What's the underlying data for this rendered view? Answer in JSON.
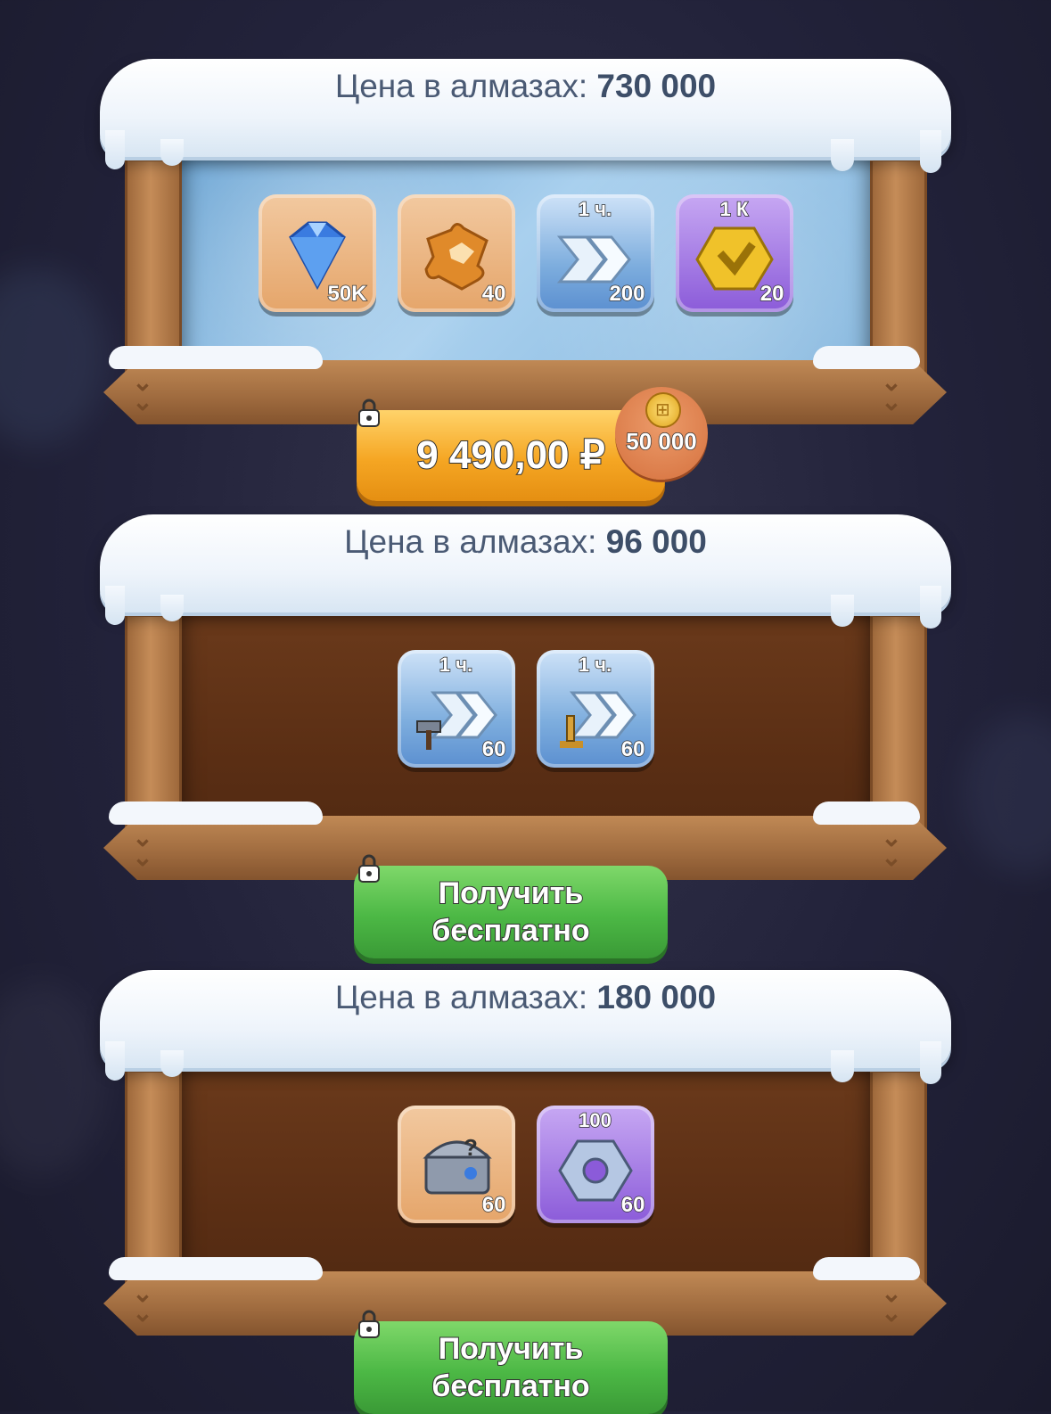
{
  "offers": [
    {
      "price_label": "Цена в алмазах:",
      "price_value": "730 000",
      "items": [
        {
          "icon": "diamond-icon",
          "count": "50K"
        },
        {
          "icon": "puzzle-piece-icon",
          "count": "40"
        },
        {
          "icon": "speedup-icon",
          "top_label": "1 ч.",
          "count": "200"
        },
        {
          "icon": "gold-hexagon-icon",
          "top_label": "1 К",
          "count": "20"
        }
      ],
      "button_label": "9 490,00 ₽",
      "bonus": "50 000"
    },
    {
      "price_label": "Цена в алмазах:",
      "price_value": "96 000",
      "items": [
        {
          "icon": "speedup-hammer-icon",
          "top_label": "1 ч.",
          "count": "60"
        },
        {
          "icon": "speedup-microscope-icon",
          "top_label": "1 ч.",
          "count": "60"
        }
      ],
      "button_label": "Получить\nбесплатно"
    },
    {
      "price_label": "Цена в алмазах:",
      "price_value": "180 000",
      "items": [
        {
          "icon": "mystery-chest-icon",
          "count": "60"
        },
        {
          "icon": "hex-nut-icon",
          "top_label": "100",
          "count": "60"
        }
      ],
      "button_label": "Получить\nбесплатно"
    }
  ],
  "colors": {
    "buy_button": "#f5a623",
    "free_button": "#4cb845",
    "price_text": "#4a5a74"
  }
}
